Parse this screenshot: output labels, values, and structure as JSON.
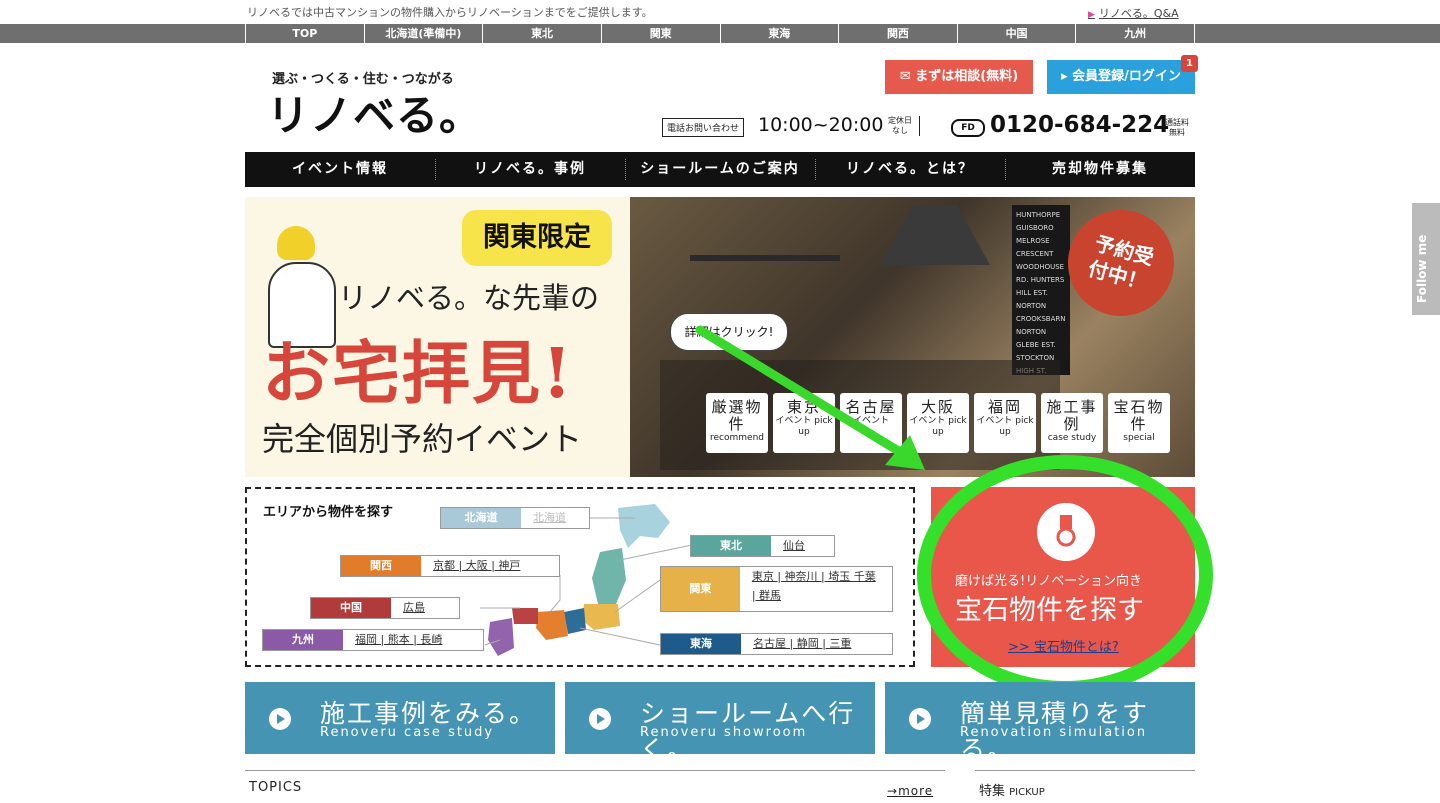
{
  "top": {
    "tagline": "リノベるでは中古マンションの物件購入からリノベーションまでをご提供します。",
    "qa_link": "リノベる。Q&A"
  },
  "region_tabs": [
    "TOP",
    "北海道(準備中)",
    "東北",
    "関東",
    "東海",
    "関西",
    "中国",
    "九州"
  ],
  "logo": {
    "sub": "選ぶ・つくる・住む・つながる",
    "main": "リノベる。"
  },
  "header": {
    "consult_button": "まずは相談(無料)",
    "login_button": "会員登録/ログイン",
    "login_badge": "1",
    "tel_label": "電話お問い合わせ",
    "tel_hours": "10:00~20:00",
    "tel_holiday": "定休日なし",
    "freedial": "FD",
    "tel_number": "0120-684-224",
    "tel_free": "通話料無料"
  },
  "nav": [
    "イベント情報",
    "リノベる。事例",
    "ショールームのご案内",
    "リノベる。とは？",
    "売却物件募集"
  ],
  "banner": {
    "badge": "関東限定",
    "line1": "リノベる。な先輩の",
    "line2": "お宅拝見!",
    "line3": "完全個別予約イベント",
    "reserve": "予約受付中！",
    "bubble": "詳細はクリック!",
    "wall_text": "HUNTHORPE GUISBORO MELROSE CRESCENT WOODHOUSE RD. HUNTERS HILL EST. NORTON CROOKSBARN NORTON GLEBE EST. STOCKTON HIGH ST.",
    "tiles": [
      {
        "main": "厳選物件",
        "sub": "recommend"
      },
      {
        "main": "東京",
        "sub": "イベント pick up"
      },
      {
        "main": "名古屋",
        "sub": "イベント"
      },
      {
        "main": "大阪",
        "sub": "イベント pick up"
      },
      {
        "main": "福岡",
        "sub": "イベント pick up"
      },
      {
        "main": "施工事例",
        "sub": "case study"
      },
      {
        "main": "宝石物件",
        "sub": "special"
      }
    ]
  },
  "area": {
    "title": "エリアから物件を探す",
    "regions": [
      {
        "name": "北海道",
        "cities": "北海道",
        "color": "#7fb2c9"
      },
      {
        "name": "東北",
        "cities": "仙台",
        "color": "#5aa59c"
      },
      {
        "name": "関西",
        "cities": "京都 | 大阪 | 神戸",
        "color": "#e07c2a"
      },
      {
        "name": "関東",
        "cities": "東京 | 神奈川 | 埼玉 千葉 | 群馬",
        "color": "#e7b14a"
      },
      {
        "name": "中国",
        "cities": "広島",
        "color": "#b13b3b"
      },
      {
        "name": "九州",
        "cities": "福岡 | 熊本 | 長崎",
        "color": "#8a5aa6"
      },
      {
        "name": "東海",
        "cities": "名古屋 | 静岡 | 三重",
        "color": "#1f5b8a"
      }
    ]
  },
  "gem": {
    "sub": "磨けば光る!リノベーション向き",
    "title": "宝石物件を探す",
    "link": ">> 宝石物件とは?"
  },
  "cta": [
    {
      "title": "施工事例をみる。",
      "sub": "Renoveru case study"
    },
    {
      "title": "ショールームへ行く。",
      "sub": "Renoveru showroom"
    },
    {
      "title": "簡単見積りをする。",
      "sub": "Renovation simulation"
    }
  ],
  "topics": {
    "title": "TOPICS",
    "more": "more"
  },
  "pickup": {
    "title": "特集",
    "sub": "PICKUP"
  },
  "follow": "Follow me"
}
